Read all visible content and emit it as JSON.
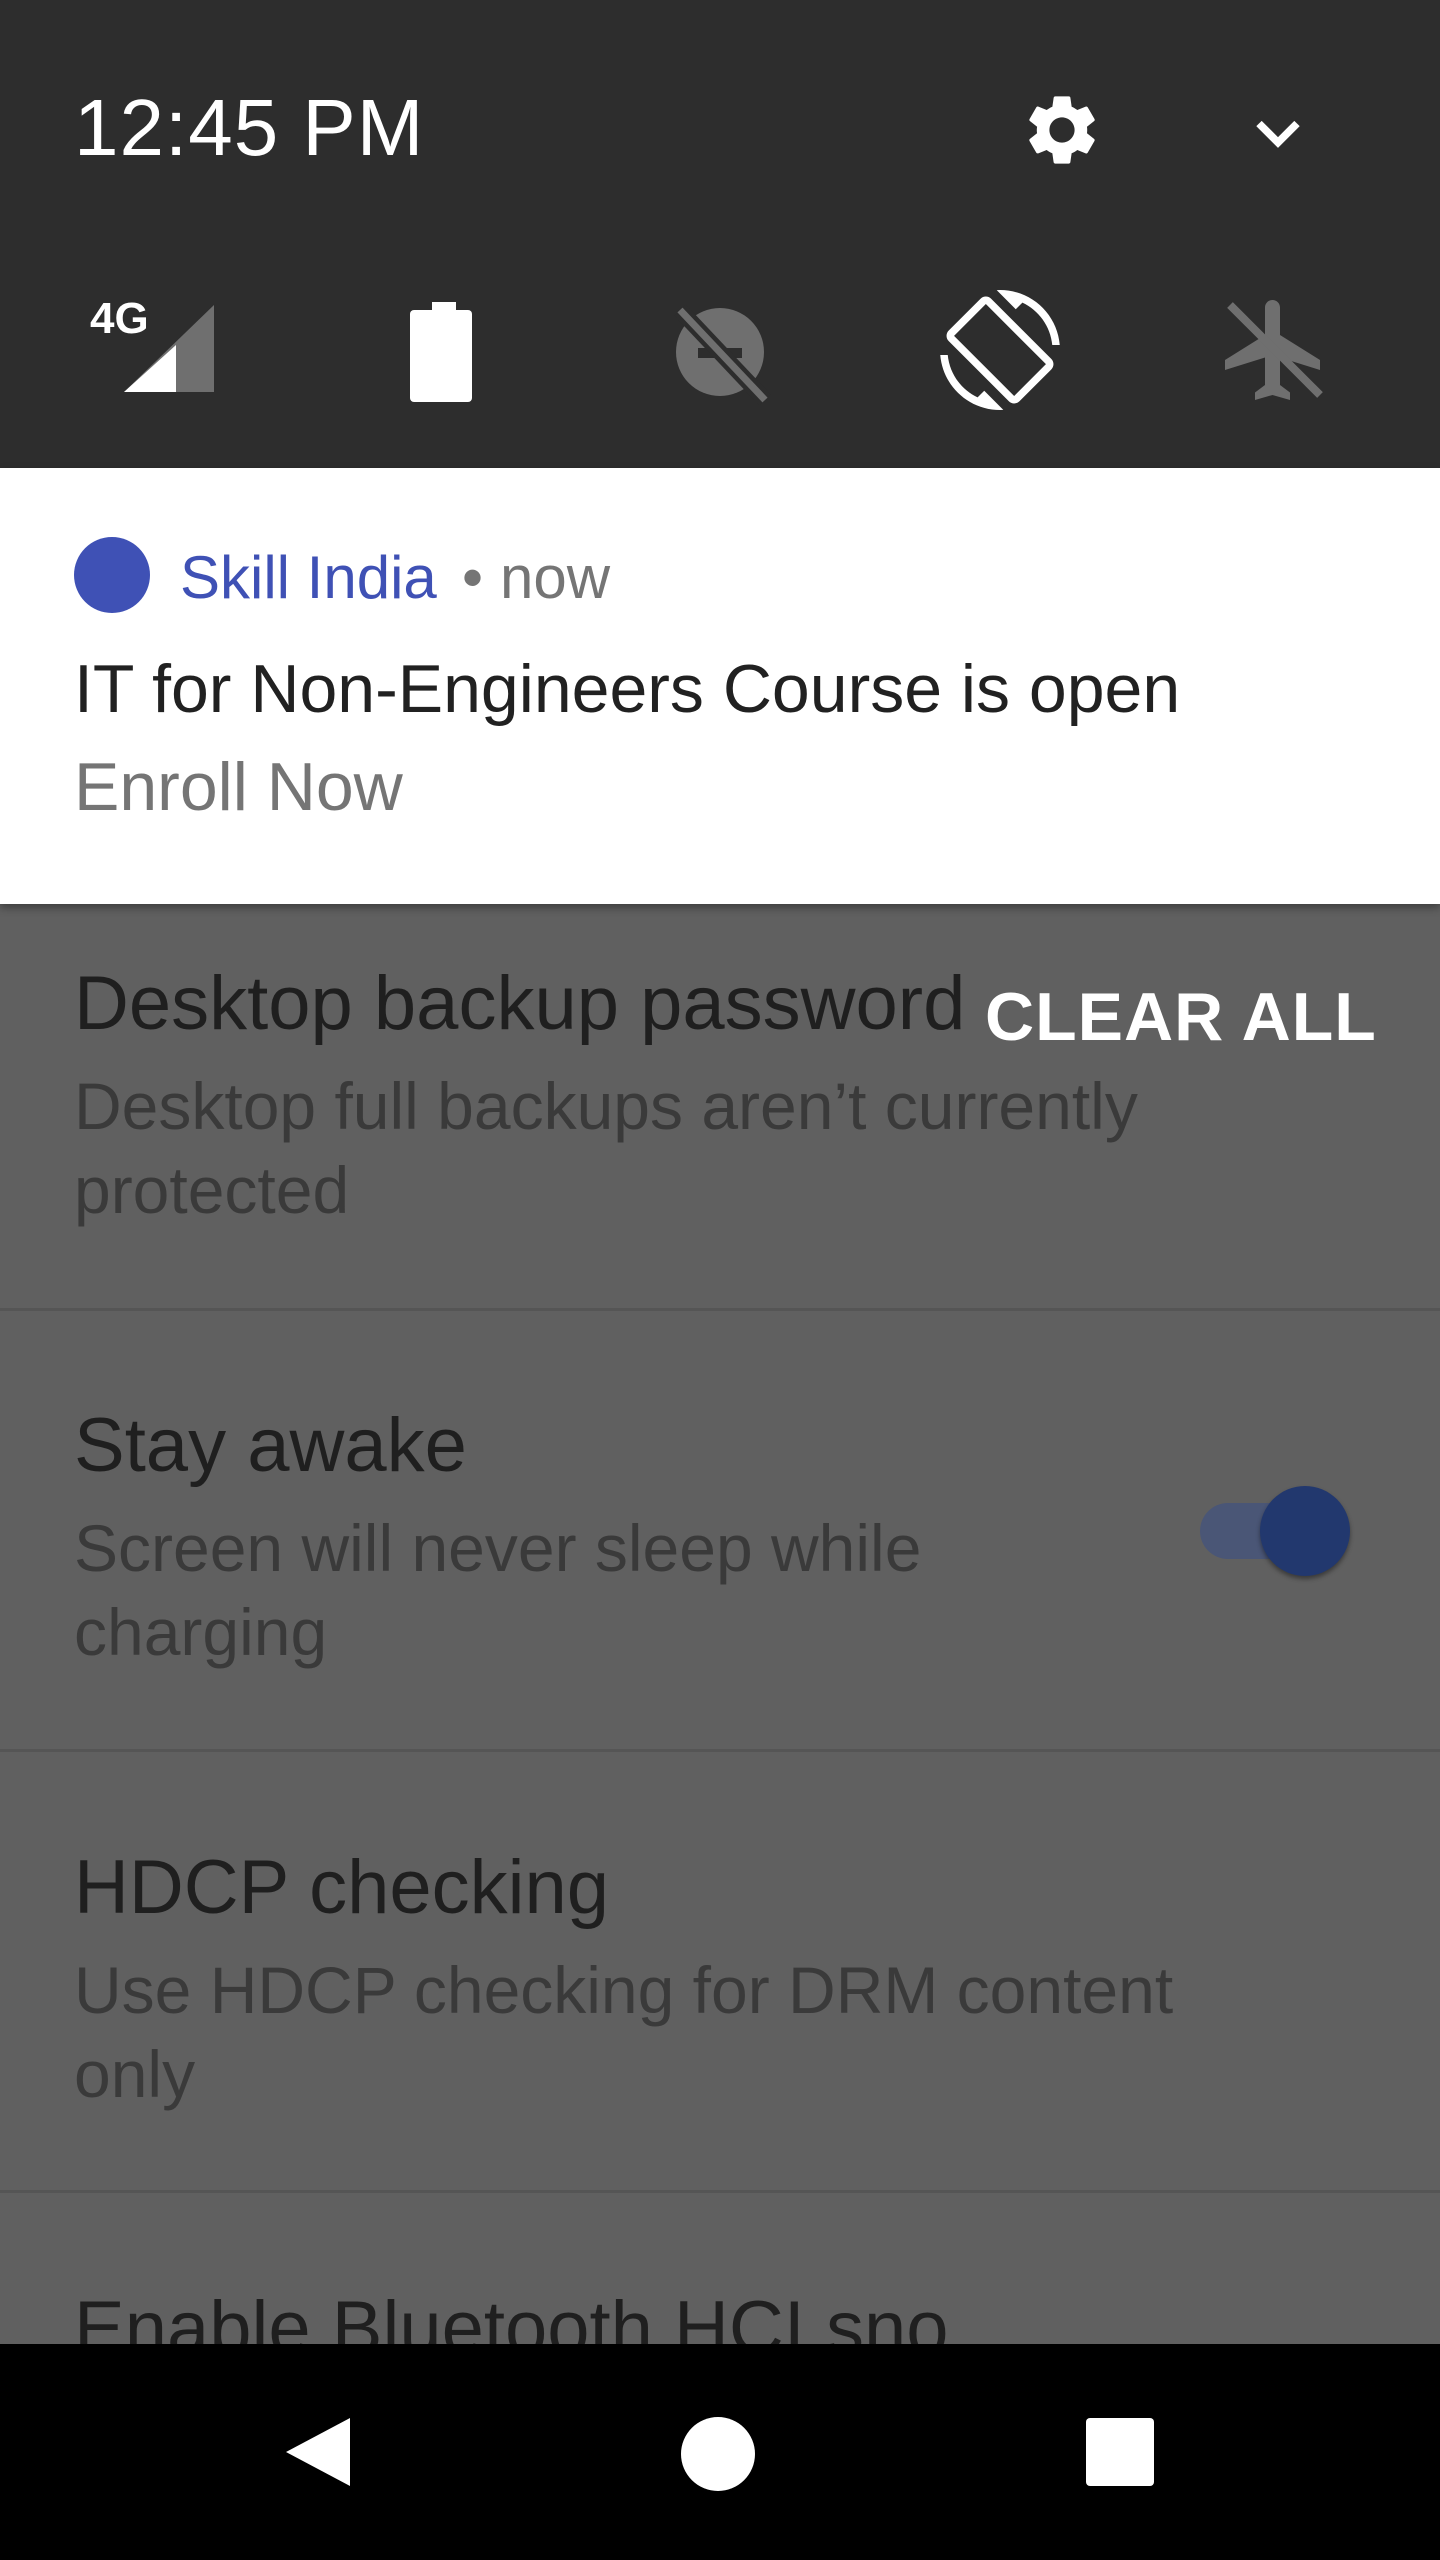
{
  "status": {
    "time": "12:45 PM",
    "network_label": "4G"
  },
  "quick_settings": {
    "icons": [
      "settings-gear-icon",
      "expand-chevron-icon",
      "signal-4g-icon",
      "battery-icon",
      "data-saver-off-icon",
      "auto-rotate-icon",
      "airplane-mode-icon"
    ]
  },
  "notification": {
    "app_name": "Skill India",
    "separator": "•",
    "time": "now",
    "title": "IT for Non-Engineers Course is open",
    "text": "Enroll Now",
    "app_color": "#3f51b5"
  },
  "actions": {
    "clear_all": "CLEAR ALL"
  },
  "settings": [
    {
      "title": "Desktop backup password",
      "subtitle": "Desktop full backups aren’t currently protected"
    },
    {
      "title": "Stay awake",
      "subtitle": "Screen will never sleep while charging",
      "toggle_on": true
    },
    {
      "title": "HDCP checking",
      "subtitle": "Use HDCP checking for DRM content only"
    },
    {
      "title": "Enable Bluetooth HCI sno",
      "subtitle": ""
    }
  ],
  "nav": {
    "icons": [
      "back-icon",
      "home-icon",
      "recents-icon"
    ]
  }
}
